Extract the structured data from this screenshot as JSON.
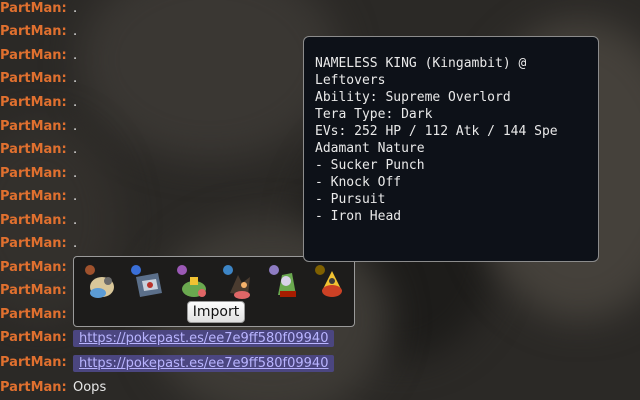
{
  "chat": {
    "messages": [
      {
        "user": "PartMan:",
        "text": "."
      },
      {
        "user": "PartMan:",
        "text": "."
      },
      {
        "user": "PartMan:",
        "text": "."
      },
      {
        "user": "PartMan:",
        "text": "."
      },
      {
        "user": "PartMan:",
        "text": "."
      },
      {
        "user": "PartMan:",
        "text": "."
      },
      {
        "user": "PartMan:",
        "text": "."
      },
      {
        "user": "PartMan:",
        "text": "."
      },
      {
        "user": "PartMan:",
        "text": "."
      },
      {
        "user": "PartMan:",
        "text": "."
      },
      {
        "user": "PartMan:",
        "text": "."
      },
      {
        "user": "PartMan:",
        "text": ""
      },
      {
        "user": "PartMan:",
        "text": ""
      },
      {
        "user": "PartMan:",
        "text": ""
      },
      {
        "user": "PartMan:",
        "link": "https://pokepast.es/ee7e9ff580f09940"
      },
      {
        "user": "PartMan:",
        "link": "https://pokepast.es/ee7e9ff580f09940"
      },
      {
        "user": "PartMan:",
        "text": "Oops"
      }
    ]
  },
  "team_preview": {
    "import_label": "Import",
    "sprites": [
      "pokemon-sprite-1",
      "pokemon-sprite-2",
      "pokemon-sprite-3",
      "pokemon-sprite-4",
      "pokemon-sprite-5",
      "pokemon-sprite-6"
    ]
  },
  "tooltip": {
    "lines": [
      "NAMELESS KING (Kingambit) @",
      "Leftovers",
      "Ability: Supreme Overlord",
      "Tera Type: Dark",
      "EVs: 252 HP / 112 Atk / 144 Spe",
      "Adamant Nature",
      "- Sucker Punch",
      "- Knock Off",
      "- Pursuit",
      "- Iron Head"
    ]
  },
  "colors": {
    "username": "#e0702f",
    "link_bg": "#4b4680",
    "link_text": "#b9b4ff",
    "tooltip_bg": "#0d1118"
  }
}
